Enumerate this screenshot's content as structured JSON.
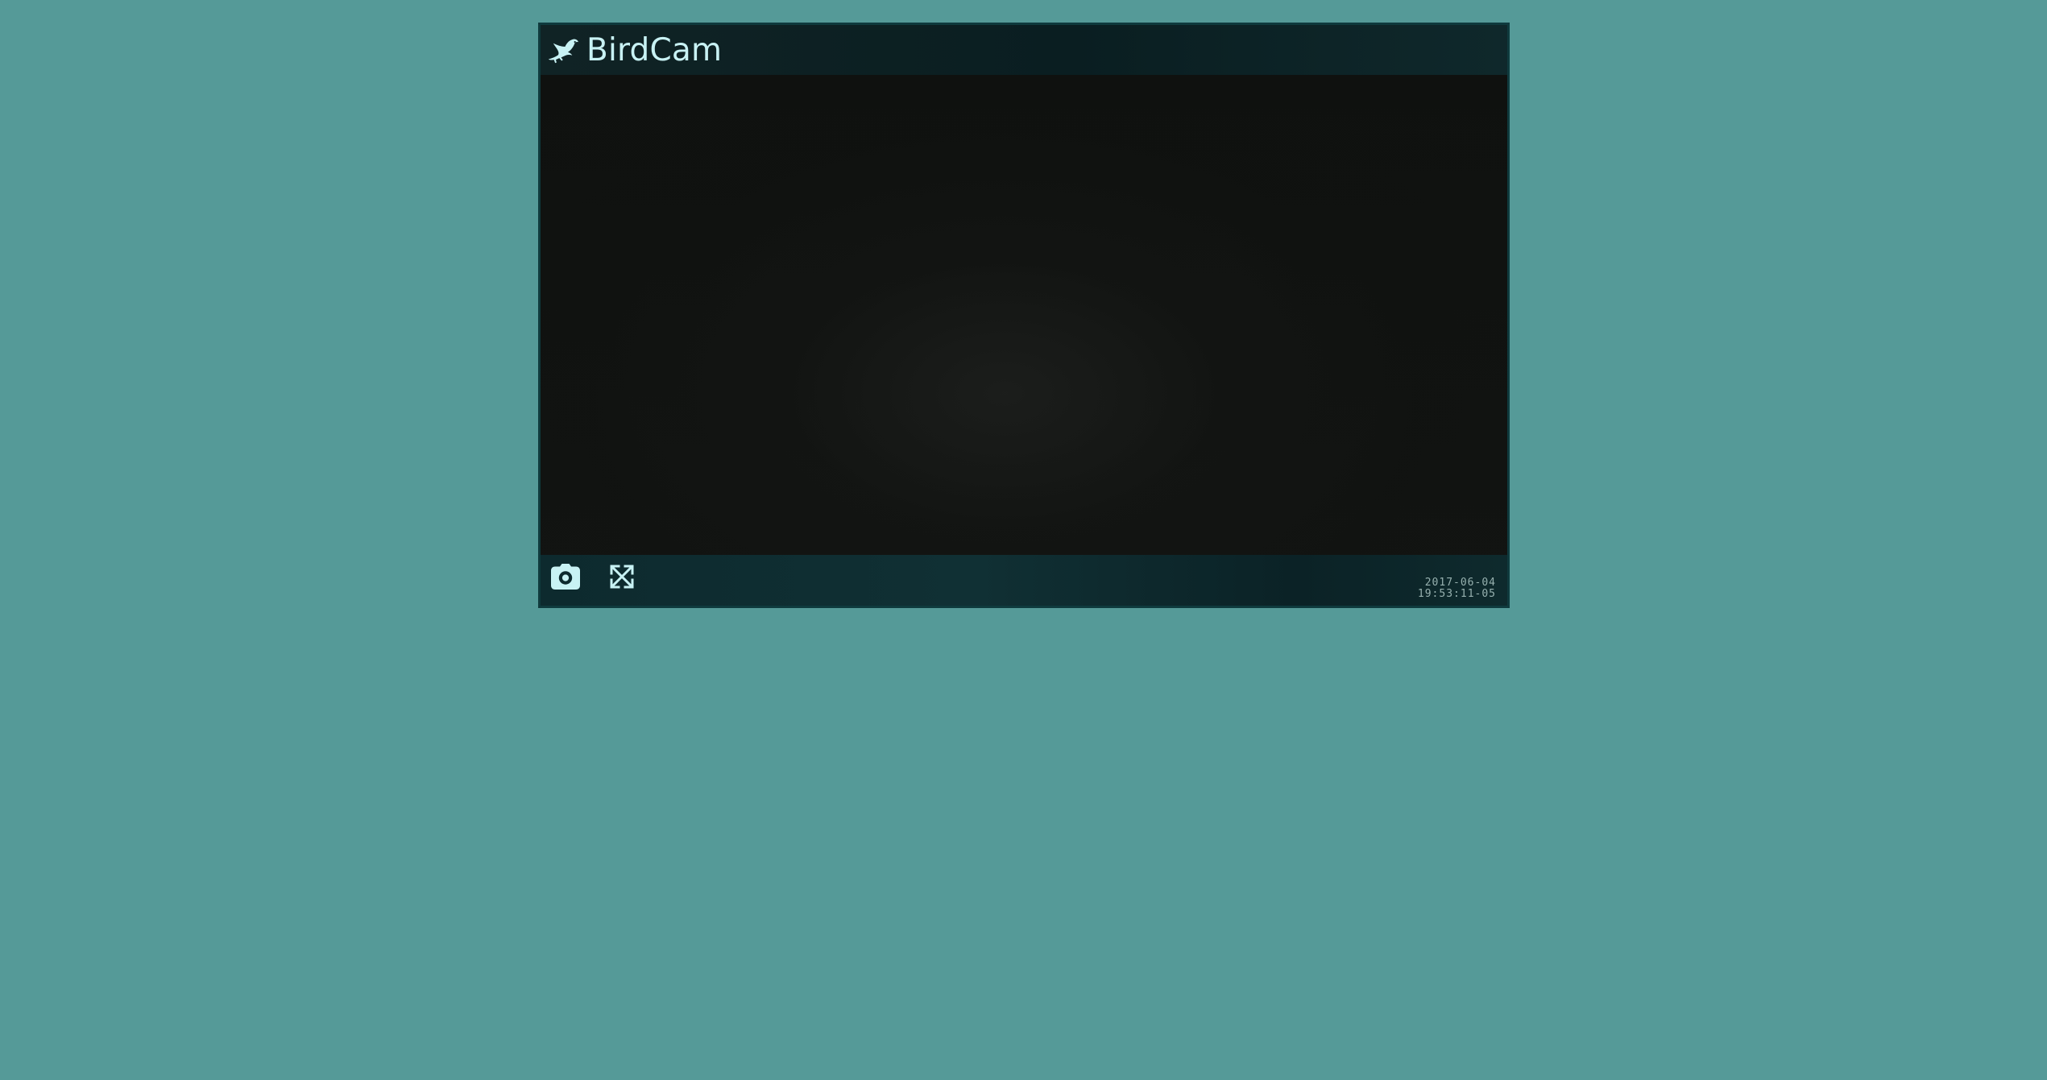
{
  "app": {
    "title": "BirdCam"
  },
  "icons": {
    "brand": "bird-icon",
    "snapshot": "camera-icon",
    "fullscreen": "fullscreen-icon"
  },
  "colors": {
    "background": "#559a98",
    "frame": "#0f3a3d",
    "accent_text": "#c8f2f4",
    "video": "#0f1110"
  },
  "overlay": {
    "date": "2017-06-04",
    "time": "19:53:11-05"
  }
}
